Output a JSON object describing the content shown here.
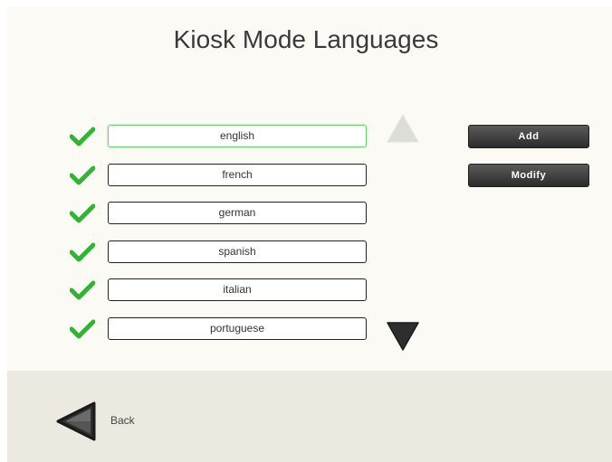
{
  "page": {
    "title": "Kiosk Mode Languages"
  },
  "languages": [
    {
      "label": "english",
      "enabled": true,
      "selected": true
    },
    {
      "label": "french",
      "enabled": true,
      "selected": false
    },
    {
      "label": "german",
      "enabled": true,
      "selected": false
    },
    {
      "label": "spanish",
      "enabled": true,
      "selected": false
    },
    {
      "label": "italian",
      "enabled": true,
      "selected": false
    },
    {
      "label": "portuguese",
      "enabled": true,
      "selected": false
    }
  ],
  "actions": {
    "add_label": "Add",
    "modify_label": "Modify"
  },
  "scroll": {
    "up_enabled": false,
    "down_enabled": true
  },
  "footer": {
    "back_label": "Back"
  },
  "icons": {
    "check": "check-icon",
    "scroll_up": "triangle-up-icon",
    "scroll_down": "triangle-down-icon",
    "back": "triangle-left-icon"
  },
  "colors": {
    "check": "#2fb52f",
    "selected_border": "#6ecf6e",
    "button_bg": "#3a3a3a",
    "footer_bg": "#ece9e1",
    "page_bg": "#fbfaf5"
  }
}
